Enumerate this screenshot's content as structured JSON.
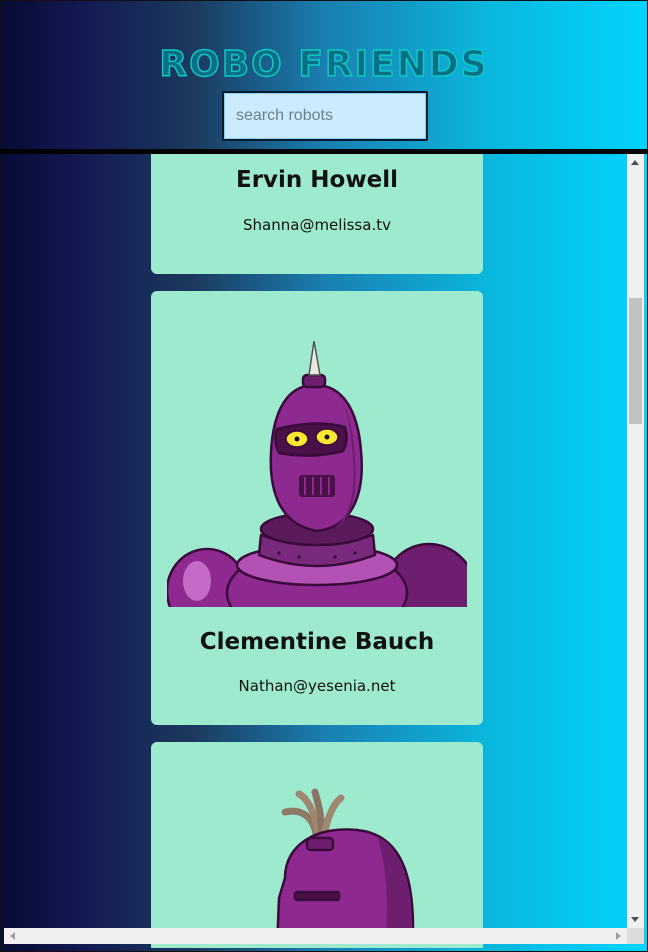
{
  "header": {
    "title": "ROBO FRIENDS"
  },
  "search": {
    "placeholder": "search robots",
    "value": ""
  },
  "robots": [
    {
      "name": "Ervin Howell",
      "email": "Shanna@melissa.tv"
    },
    {
      "name": "Clementine Bauch",
      "email": "Nathan@yesenia.net"
    },
    {
      "name": "",
      "email": ""
    }
  ],
  "colors": {
    "card_background": "#9eeacf",
    "robot_purple": "#8e2a8f",
    "search_background": "#cdebff",
    "title_color": "#0ccac4"
  },
  "icons": {
    "robot_avatar": "robot-avatar-icon"
  }
}
